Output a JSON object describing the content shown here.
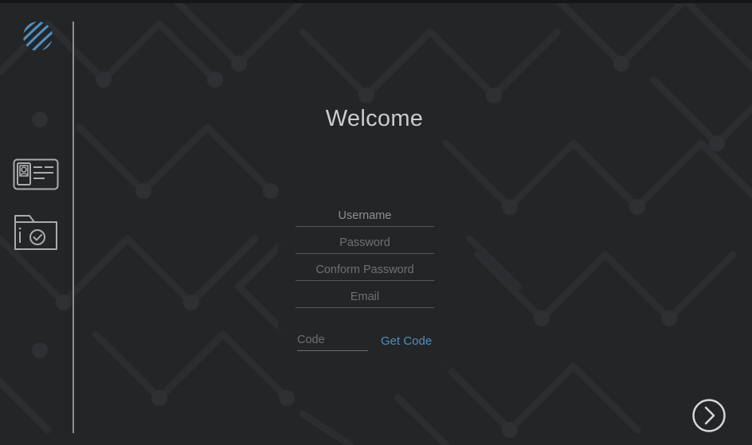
{
  "welcome": {
    "title": "Welcome"
  },
  "form": {
    "username_placeholder": "Username",
    "password_placeholder": "Password",
    "confirm_placeholder": "Conform Password",
    "email_placeholder": "Email",
    "code_placeholder": "Code",
    "get_code_label": "Get Code"
  },
  "sidebar": {
    "items": [
      {
        "icon": "id-card-icon"
      },
      {
        "icon": "folder-check-icon"
      }
    ]
  },
  "icons": {
    "logo": "wave-globe-logo",
    "next": "chevron-right-circle-icon"
  },
  "colors": {
    "background": "#232527",
    "accent": "#4f8fbf",
    "text": "#c9cbcd",
    "divider": "#8c8e90"
  }
}
